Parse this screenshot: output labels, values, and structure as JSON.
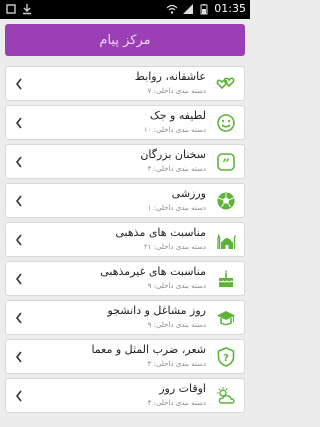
{
  "status": {
    "time": "01:35"
  },
  "header": {
    "title": "مرکز پیام"
  },
  "colors": {
    "accent": "#9b3fb5",
    "icon_green": "#5cb338"
  },
  "items": [
    {
      "title": "عاشقانه، روابط",
      "subtitle": "دسته بندی داخلی: ۷",
      "icon": "hearts-icon"
    },
    {
      "title": "لطیفه و جک",
      "subtitle": "دسته بندی داخلی: ۱۰",
      "icon": "smiley-icon"
    },
    {
      "title": "سخنان بزرگان",
      "subtitle": "دسته بندی داخلی: ۴",
      "icon": "quote-icon"
    },
    {
      "title": "ورزشی",
      "subtitle": "دسته بندی داخلی: ۱",
      "icon": "soccer-ball-icon"
    },
    {
      "title": "مناسبت های مذهبی",
      "subtitle": "دسته بندی داخلی: ۲۱",
      "icon": "mosque-icon"
    },
    {
      "title": "مناسبت های غیرمذهبی",
      "subtitle": "دسته بندی داخلی: ۹",
      "icon": "cake-icon"
    },
    {
      "title": "روز مشاغل و دانشجو",
      "subtitle": "دسته بندی داخلی: ۹",
      "icon": "graduation-cap-icon"
    },
    {
      "title": "شعر، ضرب المثل و معما",
      "subtitle": "دسته بندی داخلی: ۳",
      "icon": "question-shield-icon"
    },
    {
      "title": "اوقات روز",
      "subtitle": "دسته بندی داخلی: ۴",
      "icon": "weather-icon"
    }
  ]
}
